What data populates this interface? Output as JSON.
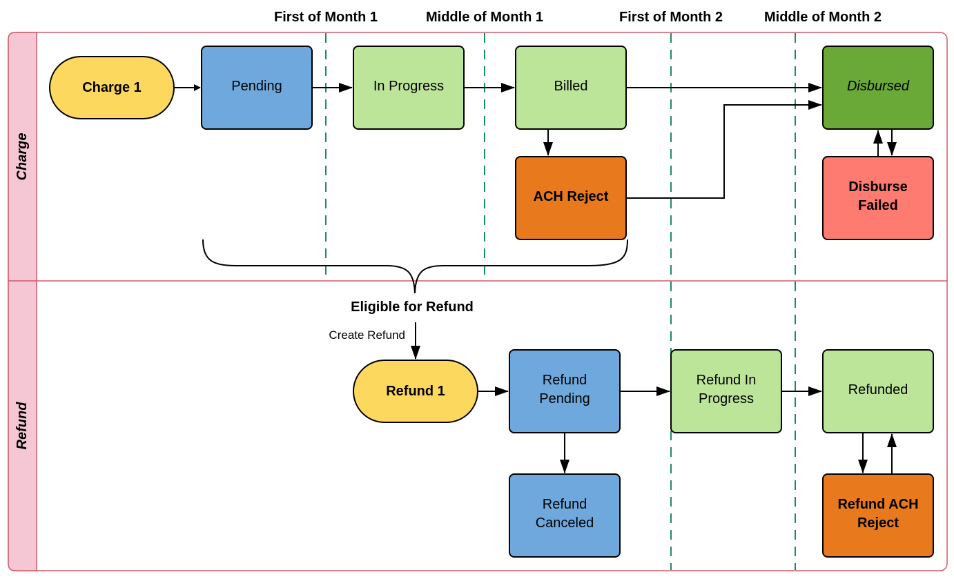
{
  "columns": [
    "First of Month 1",
    "Middle of Month 1",
    "First of Month 2",
    "Middle of Month 2"
  ],
  "lanes": {
    "charge": "Charge",
    "refund": "Refund"
  },
  "colors": {
    "lane_header": "#f5c6d4",
    "lane_border": "#d05a6a",
    "divider": "#1a8a6a",
    "start": "#fdd85e",
    "pending": "#6fa8dc",
    "progress": "#bde59a",
    "disbursed": "#6aa937",
    "reject": "#e8791d",
    "failed": "#fd7b70"
  },
  "nodes": {
    "charge1": "Charge 1",
    "pending": "Pending",
    "in_progress": "In Progress",
    "billed": "Billed",
    "ach_reject": "ACH Reject",
    "disbursed": "Disbursed",
    "disburse_failed": [
      "Disburse",
      "Failed"
    ],
    "refund1": "Refund 1",
    "refund_pending": [
      "Refund",
      "Pending"
    ],
    "refund_canceled": [
      "Refund",
      "Canceled"
    ],
    "refund_in_progress": [
      "Refund In",
      "Progress"
    ],
    "refunded": "Refunded",
    "refund_ach_reject": [
      "Refund ACH",
      "Reject"
    ]
  },
  "labels": {
    "eligible": "Eligible for Refund",
    "create_refund": "Create Refund"
  }
}
